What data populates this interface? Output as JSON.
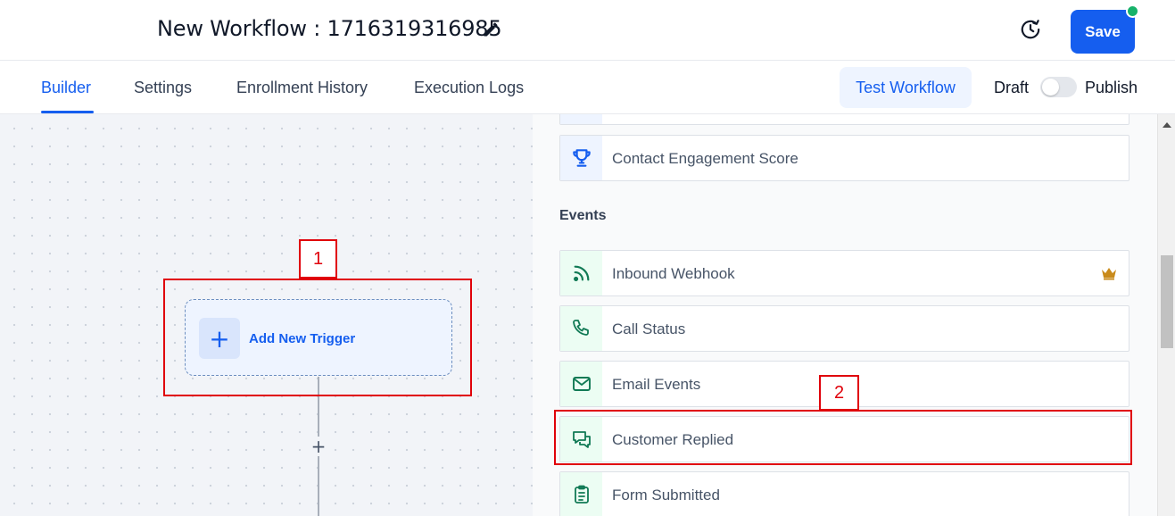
{
  "header": {
    "workflow_title": "New Workflow : 1716319316985",
    "save_label": "Save",
    "status_color": "#17b26a"
  },
  "tabs": {
    "items": [
      {
        "label": "Builder",
        "active": true
      },
      {
        "label": "Settings",
        "active": false
      },
      {
        "label": "Enrollment History",
        "active": false
      },
      {
        "label": "Execution Logs",
        "active": false
      }
    ],
    "test_workflow_label": "Test Workflow",
    "draft_label": "Draft",
    "publish_label": "Publish",
    "publish_enabled": false
  },
  "canvas": {
    "trigger_label": "Add New Trigger",
    "plus_symbol": "+",
    "add_step_symbol": "+"
  },
  "panel": {
    "top_items": [
      {
        "label": "",
        "icon": "partial-item"
      },
      {
        "label": "Contact Engagement Score",
        "icon": "trophy-icon"
      }
    ],
    "events_heading": "Events",
    "events": [
      {
        "label": "Inbound Webhook",
        "icon": "webhook-icon",
        "premium": true
      },
      {
        "label": "Call Status",
        "icon": "phone-icon"
      },
      {
        "label": "Email Events",
        "icon": "mail-icon"
      },
      {
        "label": "Customer Replied",
        "icon": "chat-bubbles-icon"
      },
      {
        "label": "Form Submitted",
        "icon": "clipboard-icon"
      }
    ]
  },
  "annotations": [
    {
      "tag": "1",
      "target": "add-new-trigger"
    },
    {
      "tag": "2",
      "target": "customer-replied"
    }
  ],
  "colors": {
    "accent": "#155eef",
    "event_icon": "#117a55",
    "annotation": "#e0000a"
  }
}
